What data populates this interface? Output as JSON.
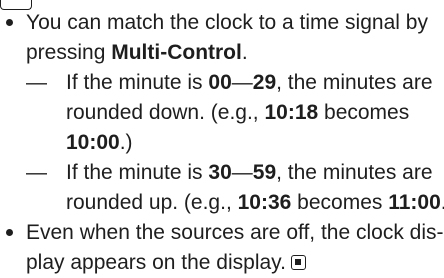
{
  "bullet1": {
    "line1": "You can match the clock to a time signal by",
    "line2_pre": "pressing ",
    "line2_bold": "Multi-Control",
    "line2_post": "."
  },
  "sub1": {
    "dash": "—",
    "line1_pre": "If the minute is ",
    "line1_bold1": "00",
    "line1_sep": "—",
    "line1_bold2": "29",
    "line1_post": ", the minutes are",
    "line2_pre": "rounded down. (e.g., ",
    "line2_bold": "10:18",
    "line2_post": " becomes",
    "line3_bold": "10:00",
    "line3_post": ".)"
  },
  "sub2": {
    "dash": "—",
    "line1_pre": "If the minute is ",
    "line1_bold1": "30",
    "line1_sep": "—",
    "line1_bold2": "59",
    "line1_post": ", the minutes are",
    "line2_pre": "rounded up. (e.g., ",
    "line2_bold1": "10:36",
    "line2_mid": " becomes ",
    "line2_bold2": "11:00",
    "line2_post": ".)"
  },
  "bullet2": {
    "line1": "Even when the sources are off, the clock dis-",
    "line2": "play appears on the display."
  },
  "icons": {
    "top": "section-tab-icon",
    "end": "end-of-section-icon"
  }
}
